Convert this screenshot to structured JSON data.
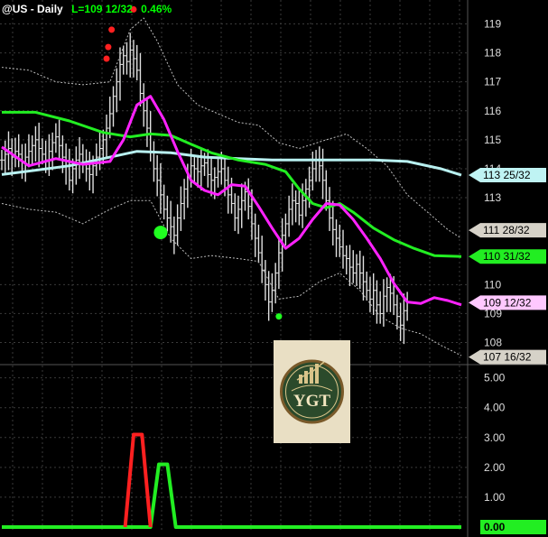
{
  "header": {
    "symbol": "@US - Daily",
    "last": "L=109 12/32",
    "change": "0.46%"
  },
  "logo": {
    "text": "YGT"
  },
  "colors": {
    "background": "#000000",
    "grid": "#3a3a3a",
    "bars": "#e0e0e0",
    "ma_fast": "#ff22ff",
    "ma_mid": "#22ee22",
    "ma_slow": "#b8f0f0",
    "envelope": "#bdbdbd",
    "dot_red": "#ff2020",
    "dot_green": "#20ff20",
    "osc_green": "#22ee22",
    "osc_red": "#ff2020"
  },
  "chart_data": [
    {
      "type": "line",
      "title": "@US - Daily",
      "y_axis_ticks": [
        108,
        109,
        110,
        113,
        114,
        115,
        116,
        117,
        118,
        119
      ],
      "ylim": [
        107.3,
        119.7
      ],
      "grid": true,
      "price_labels": [
        {
          "text": "113 25/32",
          "value": 113.78,
          "bg": "#bff3f3",
          "fg": "#000000"
        },
        {
          "text": "111 28/32",
          "value": 111.875,
          "bg": "#d6d2c8",
          "fg": "#000000"
        },
        {
          "text": "110 31/32",
          "value": 110.97,
          "bg": "#22ee22",
          "fg": "#000000"
        },
        {
          "text": "109 12/32",
          "value": 109.375,
          "bg": "#ffc8ff",
          "fg": "#000000"
        },
        {
          "text": "107 16/32",
          "value": 107.5,
          "bg": "#d6d2c8",
          "fg": "#000000"
        }
      ],
      "series": [
        {
          "kind": "price",
          "close": [
            114.3,
            114.5,
            114.7,
            114.4,
            114.6,
            114.5,
            114.2,
            114.4,
            114.6,
            114.8,
            115.0,
            114.7,
            114.5,
            114.3,
            114.6,
            114.9,
            115.1,
            114.8,
            114.4,
            114.1,
            113.6,
            114.0,
            114.3,
            114.5,
            114.2,
            114.0,
            113.8,
            114.1,
            114.4,
            114.7,
            115.0,
            115.4,
            115.9,
            116.5,
            117.0,
            117.6,
            117.9,
            117.7,
            118.1,
            117.8,
            117.4,
            116.6,
            116.0,
            115.4,
            114.6,
            114.0,
            113.6,
            113.1,
            112.6,
            112.3,
            112.0,
            111.7,
            112.3,
            112.8,
            113.3,
            113.7,
            114.1,
            114.0,
            113.9,
            114.1,
            114.2,
            113.8,
            113.6,
            113.7,
            113.9,
            114.0,
            113.6,
            113.1,
            112.8,
            112.3,
            112.6,
            112.9,
            113.2,
            112.7,
            112.1,
            111.6,
            111.1,
            110.5,
            110.0,
            109.4,
            109.8,
            110.4,
            111.1,
            111.7,
            112.1,
            112.6,
            112.9,
            112.8,
            112.4,
            112.9,
            113.3,
            113.6,
            114.0,
            114.3,
            114.1,
            113.6,
            112.9,
            112.3,
            111.9,
            111.6,
            111.3,
            111.0,
            110.9,
            110.6,
            110.4,
            110.7,
            110.4,
            110.1,
            109.8,
            109.5,
            109.8,
            109.3,
            109.0,
            109.6,
            109.9,
            109.7,
            109.3,
            108.9,
            108.6,
            109.1,
            109.4
          ]
        },
        {
          "kind": "ma_fast",
          "values": [
            [
              0,
              114.75
            ],
            [
              8,
              114.1
            ],
            [
              16,
              114.35
            ],
            [
              24,
              114.15
            ],
            [
              32,
              114.25
            ],
            [
              36,
              115.0
            ],
            [
              40,
              116.2
            ],
            [
              44,
              116.5
            ],
            [
              48,
              115.7
            ],
            [
              52,
              114.6
            ],
            [
              56,
              113.6
            ],
            [
              60,
              113.25
            ],
            [
              64,
              113.1
            ],
            [
              68,
              113.45
            ],
            [
              72,
              113.4
            ],
            [
              76,
              112.7
            ],
            [
              80,
              111.95
            ],
            [
              84,
              111.25
            ],
            [
              88,
              111.6
            ],
            [
              92,
              112.25
            ],
            [
              96,
              112.8
            ],
            [
              100,
              112.75
            ],
            [
              104,
              112.25
            ],
            [
              108,
              111.6
            ],
            [
              112,
              110.9
            ],
            [
              116,
              110.05
            ],
            [
              120,
              109.4
            ],
            [
              124,
              109.35
            ],
            [
              128,
              109.55
            ],
            [
              132,
              109.45
            ],
            [
              136,
              109.3
            ]
          ]
        },
        {
          "kind": "ma_mid",
          "values": [
            [
              0,
              115.95
            ],
            [
              10,
              115.95
            ],
            [
              20,
              115.65
            ],
            [
              30,
              115.25
            ],
            [
              38,
              115.1
            ],
            [
              44,
              115.2
            ],
            [
              50,
              115.15
            ],
            [
              56,
              114.85
            ],
            [
              62,
              114.55
            ],
            [
              70,
              114.3
            ],
            [
              78,
              114.15
            ],
            [
              84,
              113.9
            ],
            [
              88,
              113.3
            ],
            [
              92,
              112.8
            ],
            [
              96,
              112.65
            ],
            [
              100,
              112.8
            ],
            [
              104,
              112.5
            ],
            [
              110,
              111.95
            ],
            [
              116,
              111.55
            ],
            [
              122,
              111.25
            ],
            [
              128,
              111.0
            ],
            [
              136,
              110.97
            ]
          ]
        },
        {
          "kind": "ma_slow",
          "values": [
            [
              0,
              113.8
            ],
            [
              10,
              113.95
            ],
            [
              20,
              114.1
            ],
            [
              30,
              114.35
            ],
            [
              40,
              114.6
            ],
            [
              50,
              114.55
            ],
            [
              60,
              114.4
            ],
            [
              70,
              114.35
            ],
            [
              80,
              114.3
            ],
            [
              90,
              114.3
            ],
            [
              100,
              114.3
            ],
            [
              110,
              114.3
            ],
            [
              120,
              114.25
            ],
            [
              130,
              114.0
            ],
            [
              136,
              113.78
            ]
          ]
        },
        {
          "kind": "envelope_upper",
          "values": [
            [
              0,
              117.5
            ],
            [
              8,
              117.4
            ],
            [
              16,
              117.0
            ],
            [
              24,
              116.9
            ],
            [
              32,
              117.0
            ],
            [
              38,
              118.8
            ],
            [
              42,
              119.2
            ],
            [
              46,
              118.4
            ],
            [
              52,
              116.9
            ],
            [
              58,
              116.2
            ],
            [
              64,
              115.9
            ],
            [
              70,
              115.6
            ],
            [
              76,
              115.5
            ],
            [
              82,
              114.9
            ],
            [
              88,
              114.7
            ],
            [
              96,
              115.0
            ],
            [
              102,
              115.2
            ],
            [
              108,
              114.7
            ],
            [
              114,
              114.1
            ],
            [
              120,
              113.1
            ],
            [
              126,
              112.5
            ],
            [
              132,
              111.9
            ],
            [
              136,
              111.6
            ]
          ]
        },
        {
          "kind": "envelope_lower",
          "values": [
            [
              0,
              112.8
            ],
            [
              8,
              112.6
            ],
            [
              16,
              112.5
            ],
            [
              24,
              112.1
            ],
            [
              32,
              112.6
            ],
            [
              38,
              112.9
            ],
            [
              44,
              112.9
            ],
            [
              50,
              111.6
            ],
            [
              56,
              110.9
            ],
            [
              62,
              111.0
            ],
            [
              70,
              110.9
            ],
            [
              76,
              110.8
            ],
            [
              82,
              109.5
            ],
            [
              88,
              109.6
            ],
            [
              94,
              110.1
            ],
            [
              100,
              110.4
            ],
            [
              106,
              109.8
            ],
            [
              112,
              108.9
            ],
            [
              118,
              108.5
            ],
            [
              124,
              108.3
            ],
            [
              130,
              107.9
            ],
            [
              136,
              107.55
            ]
          ]
        },
        {
          "kind": "dots_red",
          "values": [
            [
              31,
              117.8
            ],
            [
              31.5,
              118.2
            ],
            [
              32.5,
              118.8
            ],
            [
              39,
              119.5
            ]
          ]
        },
        {
          "kind": "dots_green_large",
          "values": [
            [
              47,
              111.8
            ]
          ]
        },
        {
          "kind": "dots_green_small",
          "values": [
            [
              82,
              108.9
            ]
          ]
        }
      ]
    },
    {
      "type": "line",
      "title": "",
      "y_axis_ticks": [
        "5.00",
        "4.00",
        "3.00",
        "2.00",
        "1.00"
      ],
      "ylim": [
        0,
        5.2
      ],
      "grid": true,
      "value_label": "0.00",
      "series": [
        {
          "kind": "osc_green",
          "values": [
            [
              0,
              0
            ],
            [
              44,
              0
            ],
            [
              46.5,
              2.1
            ],
            [
              49,
              2.1
            ],
            [
              51.5,
              0
            ],
            [
              136,
              0
            ]
          ]
        },
        {
          "kind": "osc_red",
          "values": [
            [
              36.5,
              0
            ],
            [
              39,
              3.1
            ],
            [
              41.5,
              3.1
            ],
            [
              44,
              0
            ]
          ]
        }
      ]
    }
  ]
}
